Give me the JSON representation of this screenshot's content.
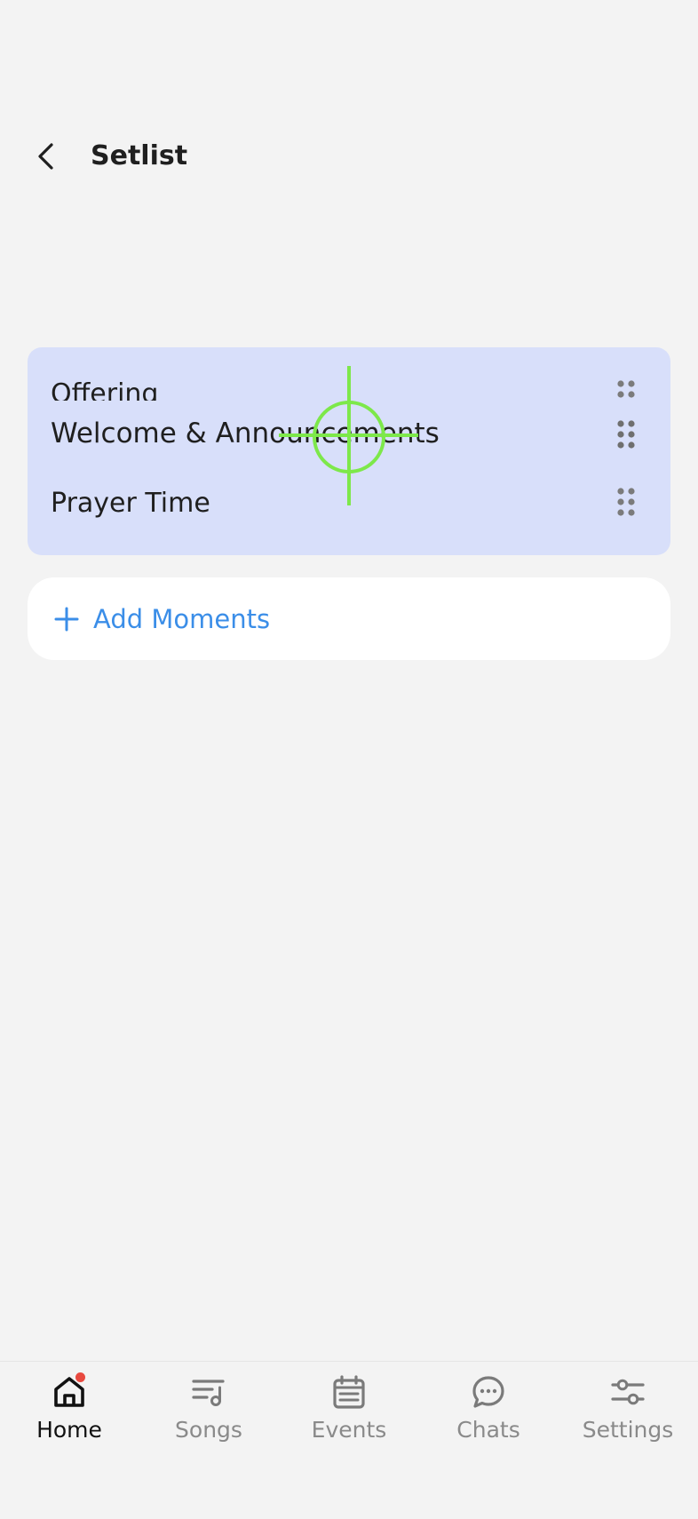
{
  "header": {
    "title": "Setlist"
  },
  "setlist": {
    "items": [
      {
        "label": "Offering"
      },
      {
        "label": "Welcome & Announcements"
      },
      {
        "label": "Prayer Time"
      }
    ]
  },
  "add_moments": {
    "label": "Add Moments"
  },
  "bottom_nav": {
    "items": [
      {
        "label": "Home",
        "icon": "home-icon",
        "active": true,
        "has_notification": true
      },
      {
        "label": "Songs",
        "icon": "songs-icon"
      },
      {
        "label": "Events",
        "icon": "calendar-icon"
      },
      {
        "label": "Chats",
        "icon": "chat-icon"
      },
      {
        "label": "Settings",
        "icon": "sliders-icon"
      }
    ]
  },
  "colors": {
    "background": "#f3f3f3",
    "list_highlight": "#d8dffa",
    "accent": "#3b8ee8",
    "notification": "#e8493f",
    "drag_cursor": "#7de84a"
  }
}
